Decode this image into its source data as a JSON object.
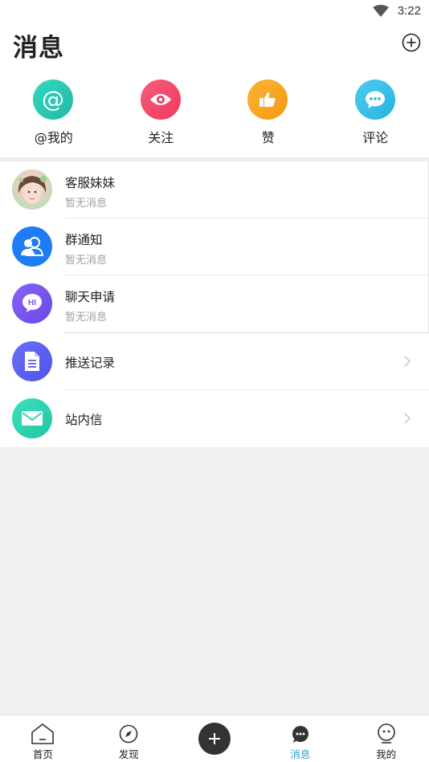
{
  "status_bar": {
    "time": "3:22"
  },
  "header": {
    "title": "消息"
  },
  "quick_actions": [
    {
      "label": "@我的",
      "icon": "at-icon",
      "color": "#2ec9b3"
    },
    {
      "label": "关注",
      "icon": "eye-icon",
      "color": "#f2486a"
    },
    {
      "label": "赞",
      "icon": "thumbs-up-icon",
      "color": "#f7a823"
    },
    {
      "label": "评论",
      "icon": "comment-icon",
      "color": "#35bfe8"
    }
  ],
  "conversations": [
    {
      "name": "客服妹妹",
      "preview": "暂无消息",
      "icon": "customer-service-avatar"
    },
    {
      "name": "群通知",
      "preview": "暂无消息",
      "icon": "group-users-icon",
      "color": "#1e7cf5"
    },
    {
      "name": "聊天申请",
      "preview": "暂无消息",
      "icon": "hi-chat-icon",
      "color": "#7a57f0"
    }
  ],
  "menu_items": [
    {
      "name": "推送记录",
      "icon": "document-icon",
      "color": "#5b5ef0"
    },
    {
      "name": "站内信",
      "icon": "mail-icon",
      "color": "#2ed3b0"
    }
  ],
  "tab_bar": {
    "tabs": [
      {
        "label": "首页",
        "icon": "home-icon"
      },
      {
        "label": "发现",
        "icon": "discover-icon"
      },
      {
        "label": "",
        "icon": "plus-icon"
      },
      {
        "label": "消息",
        "icon": "message-icon",
        "active": true,
        "active_color": "#2a9fd8"
      },
      {
        "label": "我的",
        "icon": "profile-icon"
      }
    ]
  }
}
